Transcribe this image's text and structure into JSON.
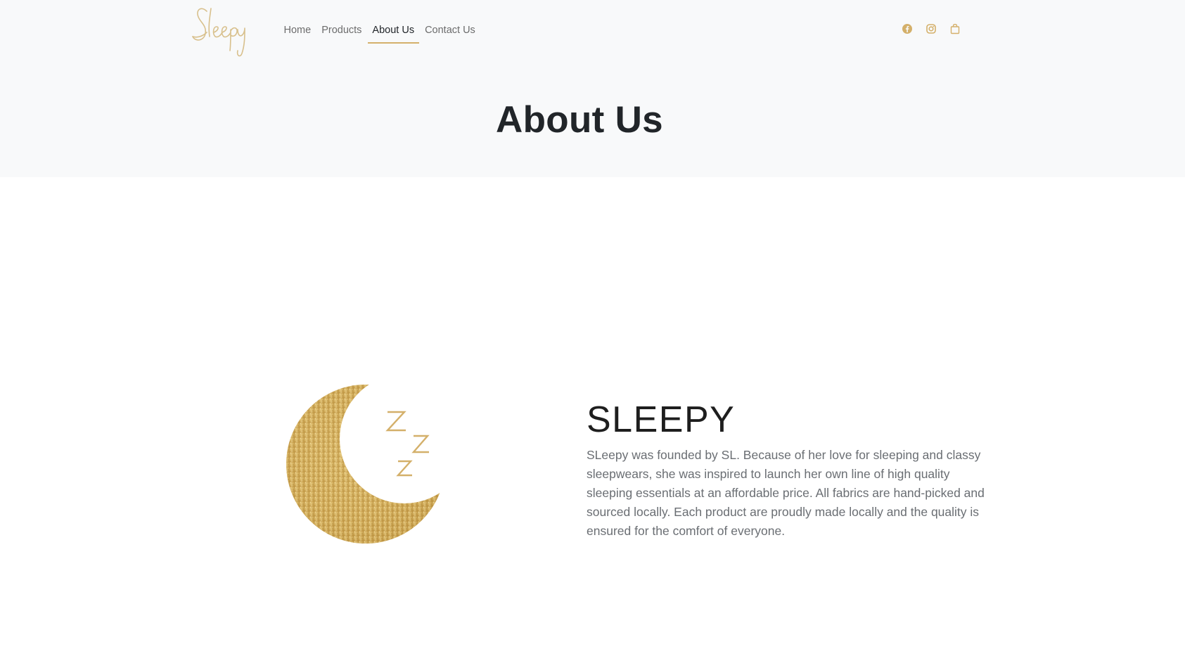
{
  "brand": {
    "logo_text": "Sleepy",
    "accent_color": "#d4b06a"
  },
  "nav": {
    "items": [
      {
        "label": "Home",
        "active": false
      },
      {
        "label": "Products",
        "active": false
      },
      {
        "label": "About Us",
        "active": true
      },
      {
        "label": "Contact Us",
        "active": false
      }
    ]
  },
  "social": {
    "icons": [
      "facebook-icon",
      "instagram-icon",
      "shopping-bag-icon"
    ]
  },
  "hero": {
    "title": "About Us"
  },
  "about": {
    "image_icon": "glitter-moon-zzz",
    "heading": "SLEEPY",
    "body": "SLeepy was founded by SL. Because of her love for sleeping and classy sleepwears, she was inspired to launch her own line of high quality sleeping essentials at an affordable price. All fabrics are hand-picked and sourced locally. Each product are proudly made locally and the quality is ensured for the comfort of everyone."
  }
}
